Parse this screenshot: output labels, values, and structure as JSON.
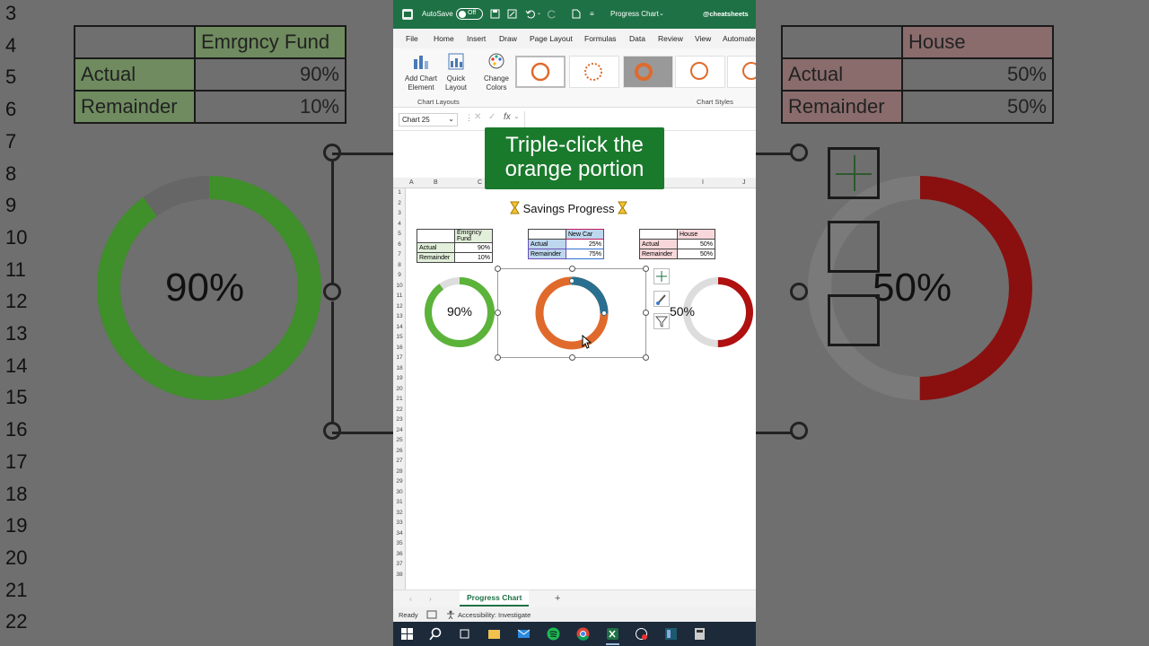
{
  "background": {
    "row_numbers": [
      "3",
      "4",
      "5",
      "6",
      "7",
      "8",
      "9",
      "10",
      "11",
      "12",
      "13",
      "14",
      "15",
      "16",
      "17",
      "18",
      "19",
      "20",
      "21",
      "22"
    ],
    "left_table": {
      "header": "Emrgncy Fund",
      "rows": [
        [
          "Actual",
          "90%"
        ],
        [
          "Remainder",
          "10%"
        ]
      ]
    },
    "left_percent": "90%",
    "right_table": {
      "header": "House",
      "rows": [
        [
          "Actual",
          "50%"
        ],
        [
          "Remainder",
          "50%"
        ]
      ]
    },
    "right_percent": "50%"
  },
  "titlebar": {
    "autosave": "AutoSave",
    "toggle": "Off",
    "doc_title": "Progress Chart",
    "watermark": "@cheatsheets"
  },
  "menu": [
    "File",
    "Home",
    "Insert",
    "Draw",
    "Page Layout",
    "Formulas",
    "Data",
    "Review",
    "View",
    "Automate"
  ],
  "ribbon": {
    "add_chart_element": [
      "Add Chart",
      "Element"
    ],
    "quick_layout": [
      "Quick",
      "Layout"
    ],
    "change_colors": [
      "Change",
      "Colors"
    ],
    "group_layouts": "Chart Layouts",
    "group_styles": "Chart Styles"
  },
  "formula_bar": {
    "name_box": "Chart 25",
    "fx": "fx"
  },
  "callout": {
    "line1": "Triple-click the",
    "line2": "orange portion"
  },
  "columns": [
    "A",
    "B",
    "C",
    "I",
    "J"
  ],
  "rows": [
    "1",
    "2",
    "3",
    "4",
    "5",
    "6",
    "7",
    "8",
    "9",
    "10",
    "11",
    "12",
    "13",
    "14",
    "15",
    "16",
    "17",
    "18",
    "19",
    "20",
    "21",
    "22",
    "23",
    "24",
    "25",
    "26",
    "27",
    "28",
    "29",
    "30",
    "31",
    "32",
    "33",
    "34",
    "35",
    "36",
    "37",
    "38"
  ],
  "sheet": {
    "title": "Savings Progress",
    "tables": [
      {
        "header": "Emrgncy Fund",
        "rows": [
          [
            "Actual",
            "90%"
          ],
          [
            "Remainder",
            "10%"
          ]
        ]
      },
      {
        "header": "New Car",
        "rows": [
          [
            "Actual",
            "25%"
          ],
          [
            "Remainder",
            "75%"
          ]
        ]
      },
      {
        "header": "House",
        "rows": [
          [
            "Actual",
            "50%"
          ],
          [
            "Remainder",
            "50%"
          ]
        ]
      }
    ],
    "charts": [
      {
        "label": "90%",
        "actual": 0.9,
        "color": "#5bb33a",
        "rest": "#dddddd"
      },
      {
        "label": "",
        "actual": 0.25,
        "color": "#2a6f8f",
        "rest": "#e06a2c"
      },
      {
        "label": "50%",
        "actual": 0.5,
        "color": "#b01010",
        "rest": "#dddddd"
      }
    ]
  },
  "sheet_tab": "Progress Chart",
  "status": {
    "ready": "Ready",
    "accessibility": "Accessibility: Investigate"
  },
  "colors": {
    "excel_green": "#1e7145",
    "callout_green": "#1a7a2c"
  }
}
